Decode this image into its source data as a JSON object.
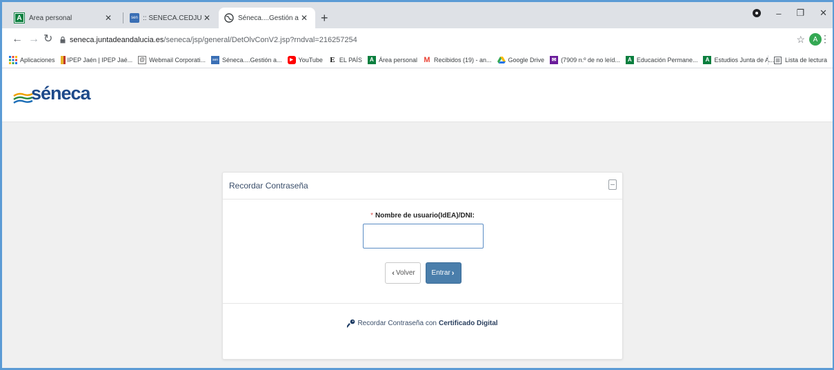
{
  "tabs": [
    {
      "title": "Área personal",
      "active": false
    },
    {
      "title": ":: SENECA.CEDJUNTA DE ANDALU",
      "active": false
    },
    {
      "title": "Séneca....Gestión académica de l",
      "active": true
    }
  ],
  "toolbar": {
    "url_host": "seneca.juntadeandalucia.es",
    "url_path": "/seneca/jsp/general/DetOlvConV2.jsp?rndval=216257254",
    "avatar_letter": "A"
  },
  "bookmarks": [
    {
      "label": "Aplicaciones",
      "icon": "apps-grid-icon"
    },
    {
      "label": "IPEP Jaén | IPEP Jaé...",
      "icon": "ipep-icon"
    },
    {
      "label": "Webmail Corporati...",
      "icon": "webmail-icon"
    },
    {
      "label": "Séneca....Gestión a...",
      "icon": "seneca-icon"
    },
    {
      "label": "YouTube",
      "icon": "youtube-icon"
    },
    {
      "label": "EL PAÍS",
      "icon": "elpais-icon"
    },
    {
      "label": "Área personal",
      "icon": "junta-icon"
    },
    {
      "label": "Recibidos (19) - an...",
      "icon": "gmail-icon"
    },
    {
      "label": "Google Drive",
      "icon": "drive-icon"
    },
    {
      "label": "(7909 n.º de no leíd...",
      "icon": "mail-icon"
    },
    {
      "label": "Educación Permane...",
      "icon": "junta-icon"
    },
    {
      "label": "Estudios Junta de A...",
      "icon": "junta-icon"
    }
  ],
  "reading_list": "Lista de lectura",
  "logo": {
    "text": "séneca"
  },
  "form": {
    "title": "Recordar Contraseña",
    "required_mark": "*",
    "field_label": "Nombre de usuario(IdEA)/DNI:",
    "field_value": "",
    "back_label": "Volver",
    "enter_label": "Entrar",
    "cert_text": "Recordar Contraseña con",
    "cert_bold": "Certificado Digital"
  },
  "colors": {
    "accent": "#4a7eab",
    "brand": "#1e4a8a",
    "required": "#d9534f"
  }
}
